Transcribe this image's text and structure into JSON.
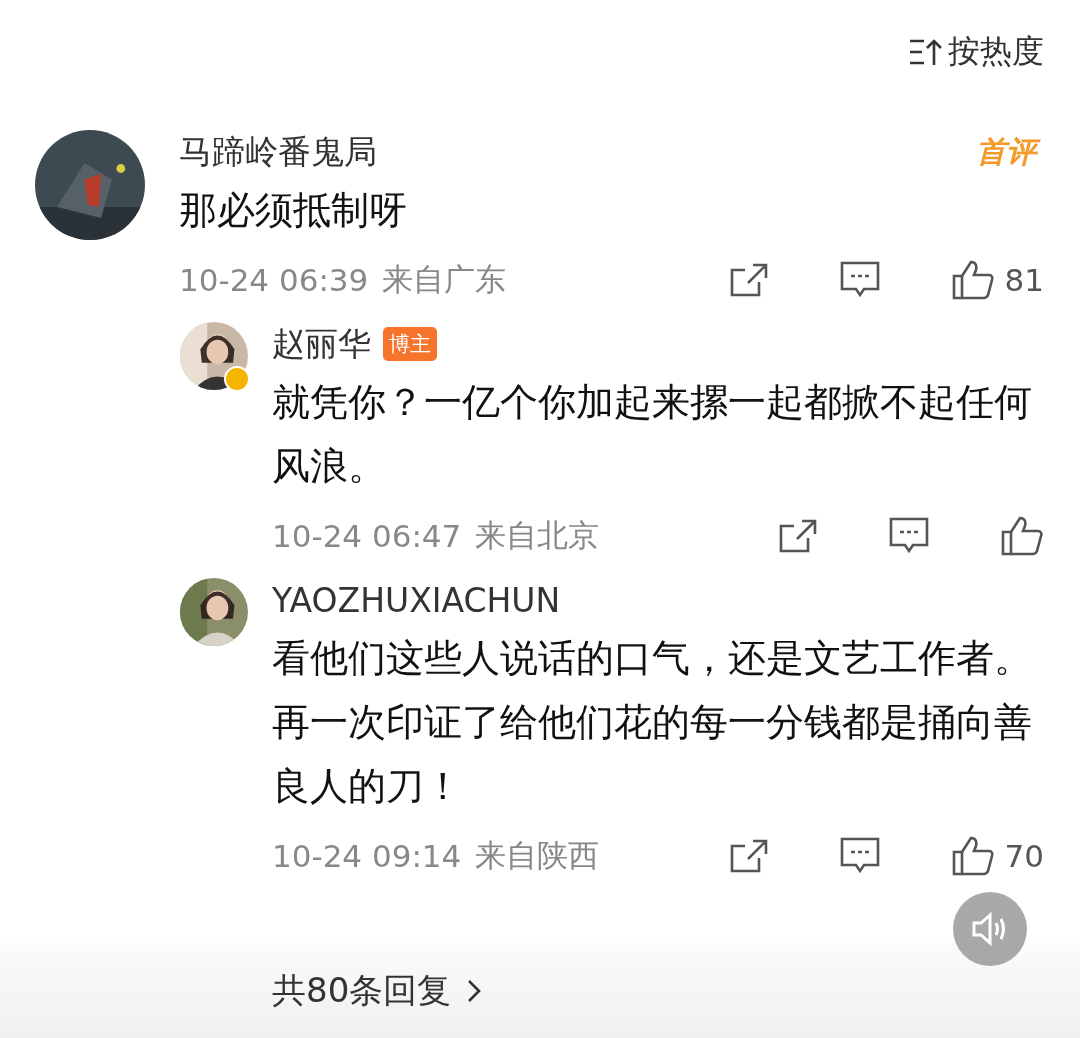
{
  "sort": {
    "label": "按热度"
  },
  "comment": {
    "author": "马蹄岭番鬼局",
    "badge": {
      "kind": "first",
      "text": "首评"
    },
    "text": "那必须抵制呀",
    "time": "10-24 06:39",
    "location": "来自广东",
    "likes": "81"
  },
  "replies": [
    {
      "author": "赵丽华",
      "verified": true,
      "badge": {
        "kind": "owner",
        "text": "博主"
      },
      "text": "就凭你？一亿个你加起来摞一起都掀不起任何风浪。",
      "time": "10-24 06:47",
      "location": "来自北京"
    },
    {
      "author": "YAOZHUXIACHUN",
      "verified": false,
      "text": "看他们这些人说话的口气，还是文艺工作者。再一次印证了给他们花的每一分钱都是捅向善良人的刀！",
      "time": "10-24 09:14",
      "location": "来自陕西",
      "likes": "70"
    }
  ],
  "more_replies": {
    "label": "共80条回复"
  }
}
